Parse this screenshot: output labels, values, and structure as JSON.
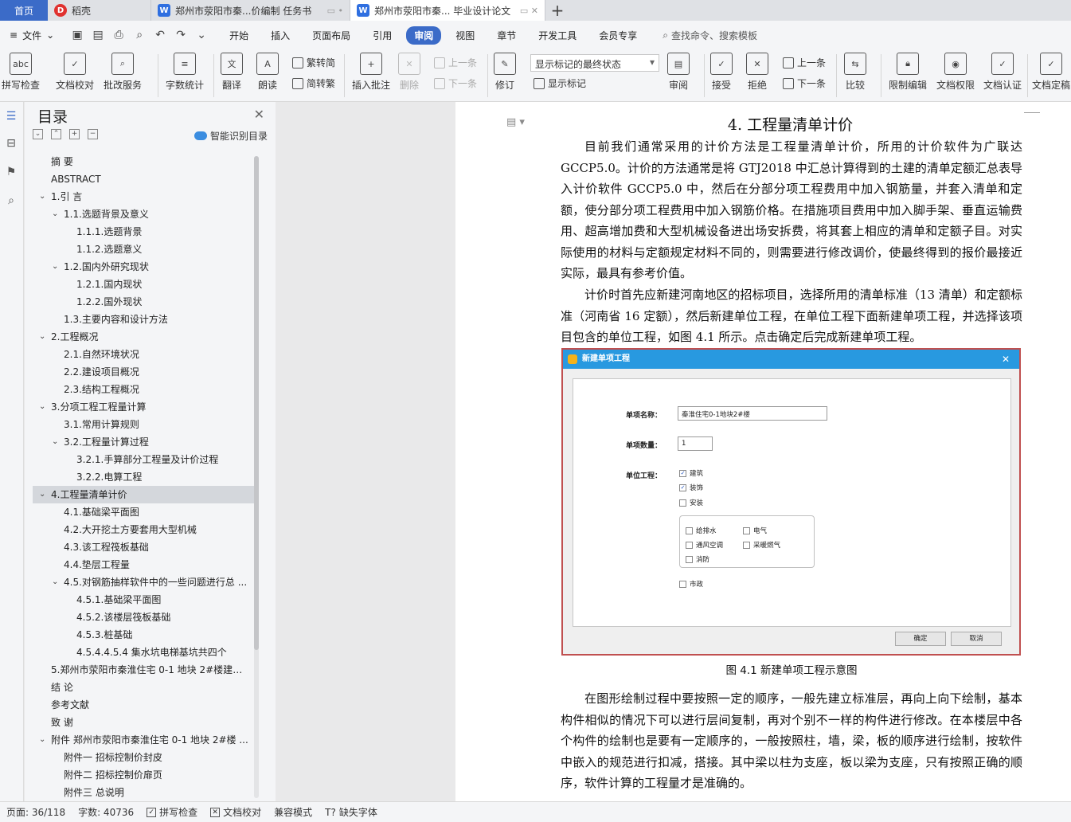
{
  "tabs": {
    "home": "首页",
    "docer": "稻壳",
    "doc1": "郑州市荥阳市秦...价编制 任务书",
    "doc2": "郑州市荥阳市秦... 毕业设计论文"
  },
  "menu": {
    "file": "文件",
    "items": [
      "开始",
      "插入",
      "页面布局",
      "引用",
      "审阅",
      "视图",
      "章节",
      "开发工具",
      "会员专享"
    ],
    "active": "审阅",
    "search": "查找命令、搜索模板"
  },
  "ribbon": {
    "spell_check": "拼写检查",
    "doc_proof": "文档校对",
    "batch_service": "批改服务",
    "word_count": "字数统计",
    "translate": "翻译",
    "read_aloud": "朗读",
    "trad_to_simp": "繁转简",
    "simp_to_trad": "简转繁",
    "insert_comment": "插入批注",
    "delete": "删除",
    "prev": "上一条",
    "next": "下一条",
    "track": "修订",
    "markup_mode": "显示标记的最终状态",
    "show_markup": "显示标记",
    "review_pane": "审阅",
    "accept": "接受",
    "reject": "拒绝",
    "prev2": "上一条",
    "next2": "下一条",
    "compare": "比较",
    "restrict_edit": "限制编辑",
    "doc_permission": "文档权限",
    "doc_cert": "文档认证",
    "doc_finalize": "文档定稿"
  },
  "toc": {
    "title": "目录",
    "smart": "智能识别目录",
    "items": [
      {
        "label": "摘  要",
        "level": 0,
        "arrow": ""
      },
      {
        "label": "ABSTRACT",
        "level": 0,
        "arrow": ""
      },
      {
        "label": "1.引  言",
        "level": 0,
        "arrow": "v"
      },
      {
        "label": "1.1.选题背景及意义",
        "level": 1,
        "arrow": "v"
      },
      {
        "label": "1.1.1.选题背景",
        "level": 2,
        "arrow": ""
      },
      {
        "label": "1.1.2.选题意义",
        "level": 2,
        "arrow": ""
      },
      {
        "label": "1.2.国内外研究现状",
        "level": 1,
        "arrow": "v"
      },
      {
        "label": "1.2.1.国内现状",
        "level": 2,
        "arrow": ""
      },
      {
        "label": "1.2.2.国外现状",
        "level": 2,
        "arrow": ""
      },
      {
        "label": "1.3.主要内容和设计方法",
        "level": 1,
        "arrow": ""
      },
      {
        "label": "2.工程概况",
        "level": 0,
        "arrow": "v"
      },
      {
        "label": "2.1.自然环境状况",
        "level": 1,
        "arrow": ""
      },
      {
        "label": "2.2.建设项目概况",
        "level": 1,
        "arrow": ""
      },
      {
        "label": "2.3.结构工程概况",
        "level": 1,
        "arrow": ""
      },
      {
        "label": "3.分项工程工程量计算",
        "level": 0,
        "arrow": "v"
      },
      {
        "label": "3.1.常用计算规则",
        "level": 1,
        "arrow": ""
      },
      {
        "label": "3.2.工程量计算过程",
        "level": 1,
        "arrow": "v"
      },
      {
        "label": "3.2.1.手算部分工程量及计价过程",
        "level": 2,
        "arrow": ""
      },
      {
        "label": "3.2.2.电算工程",
        "level": 2,
        "arrow": ""
      },
      {
        "label": "4.工程量清单计价",
        "level": 0,
        "arrow": "v",
        "selected": true
      },
      {
        "label": "4.1.基础梁平面图",
        "level": 1,
        "arrow": ""
      },
      {
        "label": "4.2.大开挖土方要套用大型机械",
        "level": 1,
        "arrow": ""
      },
      {
        "label": "4.3.该工程筏板基础",
        "level": 1,
        "arrow": ""
      },
      {
        "label": "4.4.垫层工程量",
        "level": 1,
        "arrow": ""
      },
      {
        "label": "4.5.对钢筋抽样软件中的一些问题进行总 ...",
        "level": 1,
        "arrow": "v"
      },
      {
        "label": "4.5.1.基础梁平面图",
        "level": 2,
        "arrow": ""
      },
      {
        "label": "4.5.2.该楼层筏板基础",
        "level": 2,
        "arrow": ""
      },
      {
        "label": "4.5.3.桩基础",
        "level": 2,
        "arrow": ""
      },
      {
        "label": "4.5.4.4.5.4  集水坑电梯基坑共四个",
        "level": 2,
        "arrow": ""
      },
      {
        "label": "5.郑州市荥阳市秦淮住宅 0-1 地块 2#楼建筑 ...",
        "level": 0,
        "arrow": ""
      },
      {
        "label": "结  论",
        "level": 0,
        "arrow": ""
      },
      {
        "label": "参考文献",
        "level": 0,
        "arrow": ""
      },
      {
        "label": "致  谢",
        "level": 0,
        "arrow": ""
      },
      {
        "label": "附件  郑州市荥阳市秦淮住宅 0-1 地块 2#楼 ...",
        "level": 0,
        "arrow": "v"
      },
      {
        "label": "附件一  招标控制价封皮",
        "level": 1,
        "arrow": ""
      },
      {
        "label": "附件二  招标控制价扉页",
        "level": 1,
        "arrow": ""
      },
      {
        "label": "附件三  总说明",
        "level": 1,
        "arrow": ""
      }
    ]
  },
  "document": {
    "heading": "4. 工程量清单计价",
    "para1": "目前我们通常采用的计价方法是工程量清单计价，所用的计价软件为广联达 GCCP5.0。计价的方法通常是将 GTJ2018 中汇总计算得到的土建的清单定额汇总表导入计价软件 GCCP5.0 中，然后在分部分项工程费用中加入钢筋量，并套入清单和定额，使分部分项工程费用中加入钢筋价格。在措施项目费用中加入脚手架、垂直运输费用、超高增加费和大型机械设备进出场安拆费，将其套上相应的清单和定额子目。对实际使用的材料与定额规定材料不同的，则需要进行修改调价，使最终得到的报价最接近实际，最具有参考价值。",
    "para2": "计价时首先应新建河南地区的招标项目，选择所用的清单标准（13 清单）和定额标准（河南省 16 定额），然后新建单位工程，在单位工程下面新建单项工程，并选择该项目包含的单位工程，如图 4.1 所示。点击确定后完成新建单项工程。",
    "caption": "图 4.1  新建单项工程示意图",
    "para3": "在图形绘制过程中要按照一定的顺序，一般先建立标准层，再向上向下绘制，基本构件相似的情况下可以进行层间复制，再对个别不一样的构件进行修改。在本楼层中各个构件的绘制也是要有一定顺序的，一般按照柱，墙，梁，板的顺序进行绘制，按软件中嵌入的规范进行扣减，搭接。其中梁以柱为支座，板以梁为支座，只有按照正确的顺序，软件计算的工程量才是准确的。"
  },
  "dialog": {
    "title": "新建单项工程",
    "name_label": "单项名称：",
    "name_value": "秦淮住宅0-1地块2#楼",
    "count_label": "单项数量：",
    "count_value": "1",
    "units_label": "单位工程：",
    "chk_building": "建筑",
    "chk_decoration": "装饰",
    "chk_install": "安装",
    "chk_water": "给排水",
    "chk_electric": "电气",
    "chk_hvac": "通风空调",
    "chk_heating": "采暖燃气",
    "chk_fire": "消防",
    "chk_municipal": "市政",
    "ok": "确定",
    "cancel": "取消"
  },
  "status": {
    "page": "页面: 36/118",
    "words": "字数: 40736",
    "spell": "拼写检查",
    "proof": "文档校对",
    "compat": "兼容模式",
    "missing_font": "缺失字体"
  }
}
